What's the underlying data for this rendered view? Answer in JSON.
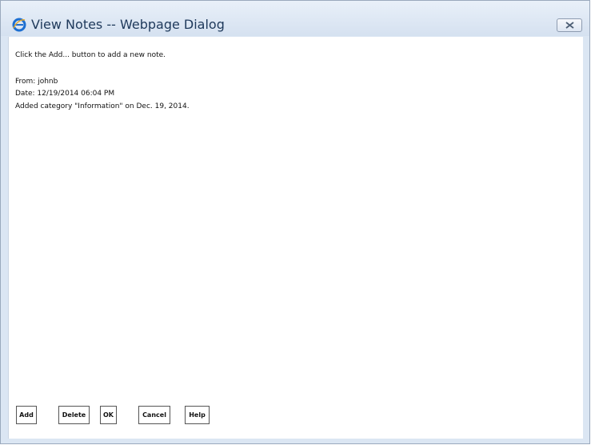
{
  "window": {
    "title": "View Notes -- Webpage Dialog",
    "title_icon": "internet-explorer-icon",
    "close_icon": "close-icon"
  },
  "content": {
    "instructions": "Click the Add... button to add a new note.",
    "note": {
      "from": "From: johnb",
      "date": "Date:  12/19/2014 06:04 PM",
      "body": "Added category \"Information\" on Dec. 19, 2014."
    }
  },
  "buttons": {
    "add": "Add",
    "delete": "Delete",
    "ok": "OK",
    "cancel": "Cancel",
    "help": "Help"
  },
  "colors": {
    "title_text": "#1e395b",
    "frame": "#dbe6f3",
    "ie_blue": "#1d6fd1",
    "ie_gold": "#e2a72d"
  }
}
